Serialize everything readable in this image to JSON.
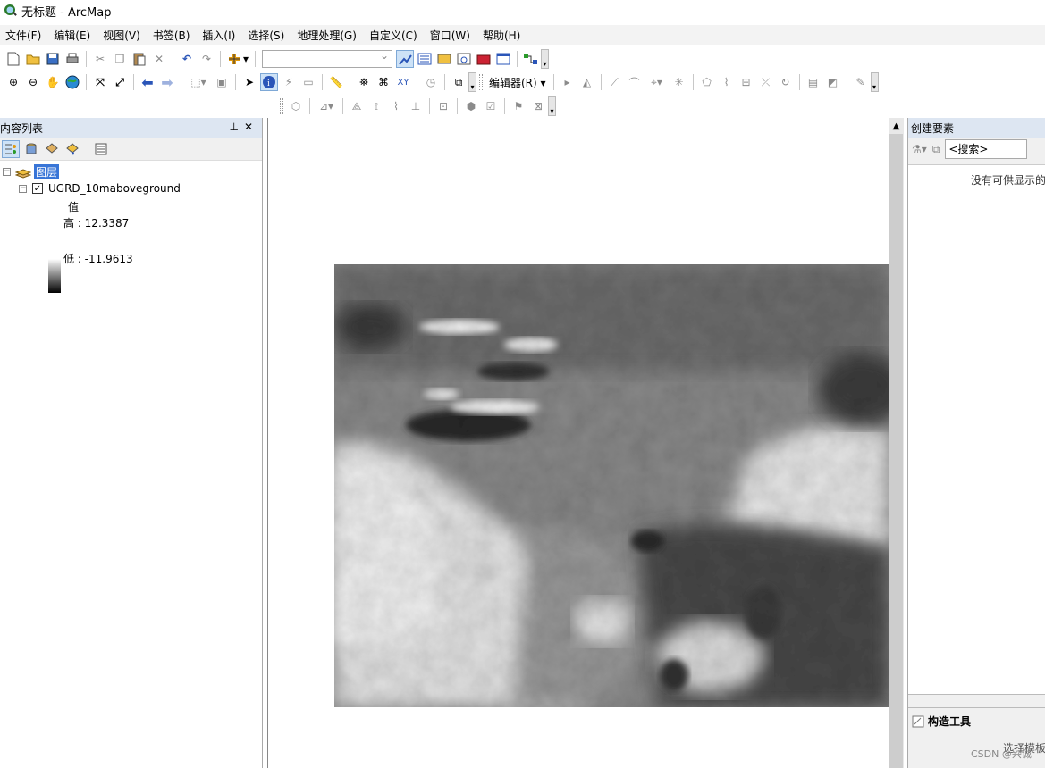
{
  "window": {
    "title": "无标题 - ArcMap"
  },
  "menu": [
    "文件(F)",
    "编辑(E)",
    "视图(V)",
    "书签(B)",
    "插入(I)",
    "选择(S)",
    "地理处理(G)",
    "自定义(C)",
    "窗口(W)",
    "帮助(H)"
  ],
  "toolbar": {
    "editor_label": "编辑器(R)",
    "scale_value": ""
  },
  "toc": {
    "title": "内容列表",
    "layers_label": "图层",
    "layer_name": "UGRD_10maboveground",
    "legend_title": "值",
    "high_label": "高 : 12.3387",
    "low_label": "低 : -11.9613"
  },
  "create_features": {
    "title": "创建要素",
    "search_placeholder": "<搜索>",
    "no_templates": "没有可供显示的",
    "construction_tools": "构造工具",
    "select_template": "选择模板"
  },
  "watermark": "CSDN @兴诚"
}
